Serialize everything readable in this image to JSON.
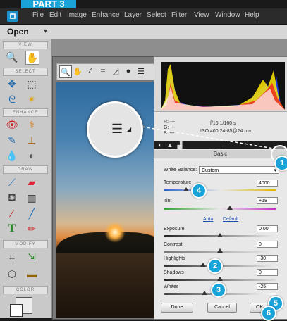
{
  "top_tab": {
    "label": "PART 3"
  },
  "menubar": {
    "items": [
      "File",
      "Edit",
      "Image",
      "Enhance",
      "Layer",
      "Select",
      "Filter",
      "View",
      "Window",
      "Help"
    ]
  },
  "options_bar": {
    "open_label": "Open"
  },
  "toolbox": {
    "sections": [
      "VIEW",
      "SELECT",
      "ENHANCE",
      "DRAW",
      "MODIFY",
      "COLOR"
    ]
  },
  "histogram_info": {
    "r": "R:  ---",
    "g": "G:  ---",
    "b": "B:  ---",
    "aperture_shutter": "f/16   1/160 s",
    "iso_lens": "ISO 400   24-85@24 mm"
  },
  "panel": {
    "title": "Basic",
    "white_balance_label": "White Balance:",
    "white_balance_value": "Custom",
    "temperature_label": "Temperature",
    "temperature_value": "4000",
    "tint_label": "Tint",
    "tint_value": "+18",
    "auto_label": "Auto",
    "default_label": "Default",
    "exposure_label": "Exposure",
    "exposure_value": "0.00",
    "contrast_label": "Contrast",
    "contrast_value": "0",
    "highlights_label": "Highlights",
    "highlights_value": "-30",
    "shadows_label": "Shadows",
    "shadows_value": "0",
    "whites_label": "Whites",
    "whites_value": "-25"
  },
  "buttons": {
    "done": "Done",
    "cancel": "Cancel",
    "ok": "OK"
  },
  "callouts": [
    "1",
    "2",
    "3",
    "4",
    "5",
    "6"
  ]
}
